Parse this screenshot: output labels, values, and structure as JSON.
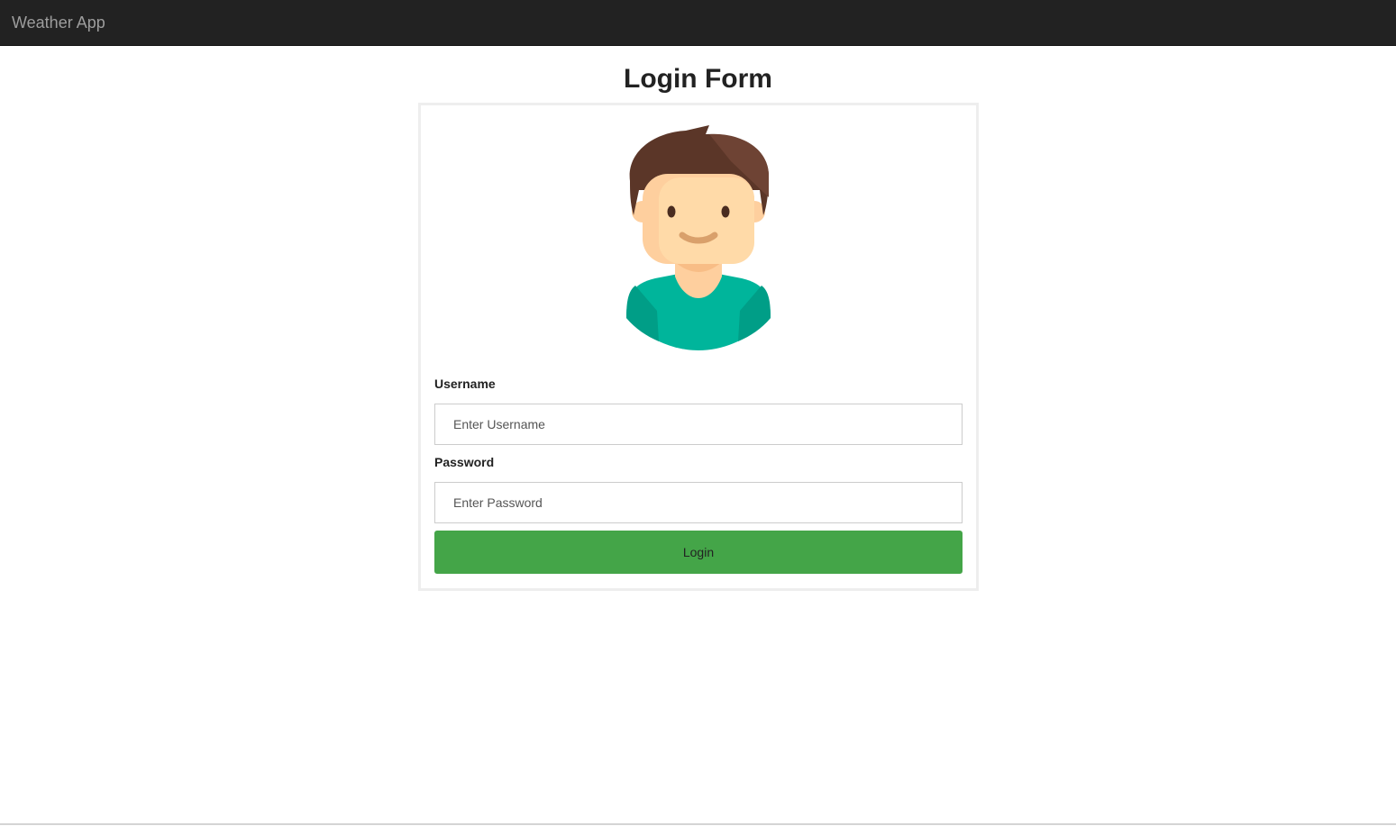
{
  "navbar": {
    "brand": "Weather App",
    "background": "#222222",
    "brand_color": "#9d9d9d"
  },
  "page": {
    "title": "Login Form"
  },
  "form": {
    "avatar_icon": "user-avatar-icon",
    "username": {
      "label": "Username",
      "placeholder": "Enter Username",
      "value": ""
    },
    "password": {
      "label": "Password",
      "placeholder": "Enter Password",
      "value": ""
    },
    "submit_label": "Login",
    "submit_color": "#44a548"
  }
}
